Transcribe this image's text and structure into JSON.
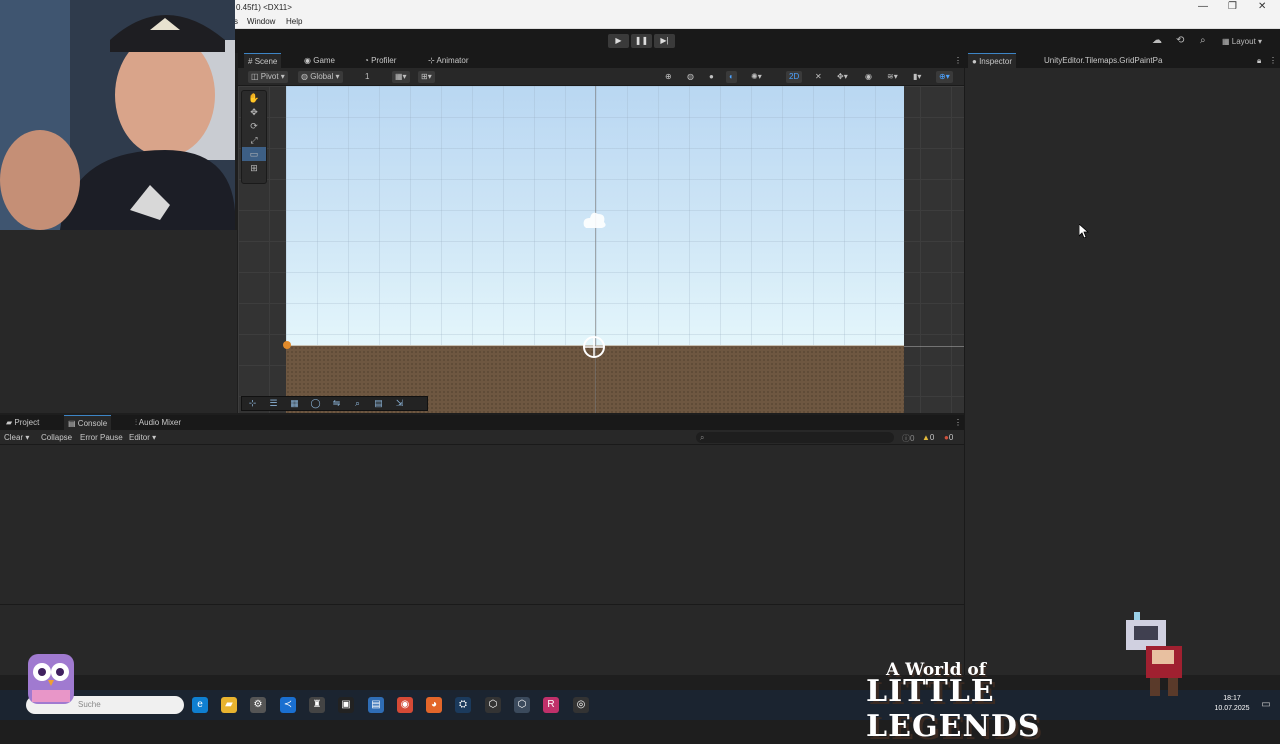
{
  "window": {
    "title": "0.45f1) <DX11>",
    "menu": [
      "s",
      "Window",
      "Help"
    ]
  },
  "toolbar": {
    "play": "▶",
    "pause": "❚❚",
    "step": "▶|",
    "layout_label": "Layout"
  },
  "scene_tabs": [
    {
      "label": "Scene",
      "icon": "grid-icon"
    },
    {
      "label": "Game",
      "icon": "gamepad-icon"
    },
    {
      "label": "Profiler",
      "icon": "profiler-icon"
    },
    {
      "label": "Animator",
      "icon": "animator-icon"
    }
  ],
  "scene_toolbar": {
    "pivot": "Pivot",
    "global": "Global",
    "grid_count": "1",
    "mode_2d": "2D"
  },
  "inspector_tabs": [
    {
      "label": "Inspector"
    },
    {
      "label": "UnityEditor.Tilemaps.GridPaintPa"
    }
  ],
  "console_tabs": [
    {
      "label": "Project"
    },
    {
      "label": "Console"
    },
    {
      "label": "Audio Mixer"
    }
  ],
  "console_bar": {
    "clear": "Clear",
    "collapse": "Collapse",
    "error_pause": "Error Pause",
    "editor": "Editor",
    "error_count": "0",
    "warning_count": "0",
    "info_count": "0"
  },
  "taskbar": {
    "search_placeholder": "Suche",
    "time": "18:17",
    "date": "10.07.2025"
  },
  "overlay": {
    "logo_line1": "A World of",
    "logo_line2": "LITTLE LEGENDS"
  },
  "colors": {
    "accent": "#3d85c6",
    "panel": "#282828",
    "sky_top": "#b9d7f2",
    "ground": "#6e5741"
  }
}
